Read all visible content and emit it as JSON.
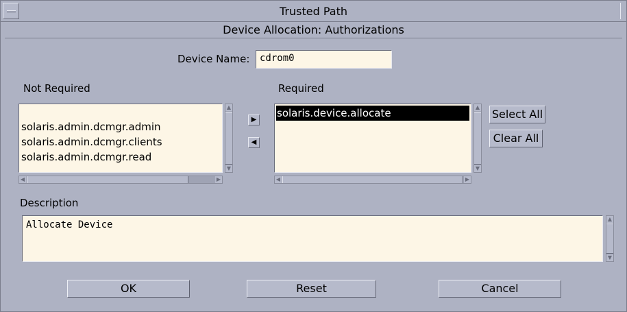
{
  "window": {
    "title": "Trusted Path",
    "subtitle": "Device Allocation: Authorizations"
  },
  "device": {
    "label": "Device Name:",
    "value": "cdrom0"
  },
  "not_required": {
    "heading": "Not Required",
    "items": [
      "solaris.admin.dcmgr.admin",
      "solaris.admin.dcmgr.clients",
      "solaris.admin.dcmgr.read"
    ]
  },
  "required": {
    "heading": "Required",
    "items": [
      "solaris.device.allocate"
    ],
    "selected_index": 0
  },
  "side_buttons": {
    "select_all": "Select All",
    "clear_all": "Clear All"
  },
  "description": {
    "heading": "Description",
    "text": "Allocate Device"
  },
  "footer": {
    "ok": "OK",
    "reset": "Reset",
    "cancel": "Cancel"
  },
  "icons": {
    "move_right": "arrow-right-icon",
    "move_left": "arrow-left-icon",
    "window_menu": "window-menu-icon"
  }
}
